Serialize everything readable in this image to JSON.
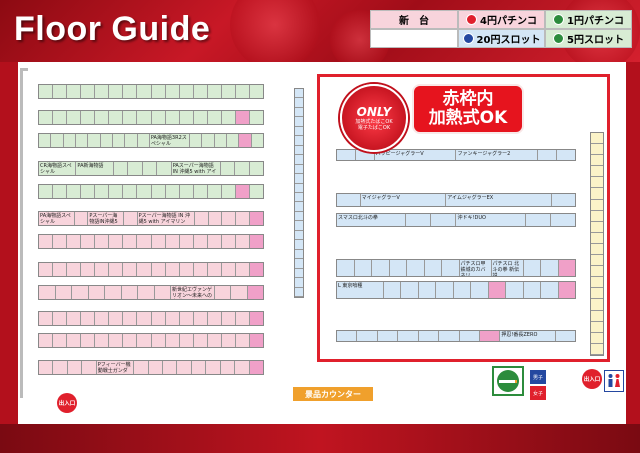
{
  "header": {
    "title": "Floor Guide"
  },
  "legend": {
    "items": [
      {
        "label": "新　台",
        "bg": "#f8d4dc",
        "dot": ""
      },
      {
        "label": "4円パチンコ",
        "bg": "#f8d4dc",
        "dot": "#e0202c",
        "num": "4"
      },
      {
        "label": "1円パチンコ",
        "bg": "#d8ecd4",
        "dot": "#2c8c3c",
        "num": "1"
      },
      {
        "label": "",
        "bg": "#ffffff",
        "dot": "",
        "num": ""
      },
      {
        "label": "20円スロット",
        "bg": "#d4e6f6",
        "dot": "#2448a0",
        "num": "20"
      },
      {
        "label": "5円スロット",
        "bg": "#d8ecd4",
        "dot": "#2c8c3c",
        "num": "5"
      }
    ]
  },
  "promo": {
    "only_badge_top": "ONLY",
    "only_badge_line1": "加熱式たばこOK",
    "only_badge_line2": "電子たばこOK",
    "heat_line1": "赤枠内",
    "heat_line2": "加熱式OK"
  },
  "rows": {
    "g1_labels": [
      "",
      "",
      "",
      "",
      "",
      "",
      "",
      "",
      "",
      "",
      "",
      "",
      "",
      "",
      "",
      "",
      "",
      "",
      "",
      "",
      "",
      ""
    ],
    "g3_big": [
      "CR海物語スペシャル",
      "PA新海物語"
    ],
    "g3_mid": "PAスーパー海物語 IN 沖縄5 with アイマリン",
    "g2_mid": "PA海物語3R2スペシャル",
    "p1_big": [
      "PA海物語スペシャル",
      "Pスーパー海物語IN沖縄5"
    ],
    "p1_mid": "Pスーパー海物語 IN 沖縄5 with アイマリン",
    "p2_mid": "新世紀エヴァンゲリオン～未来への咆哮～",
    "p4_mid": "Pフィーバー機動戦士ガンダム",
    "b1_cells": [
      "ハッピージャグラーV",
      "ファンキージャグラー2"
    ],
    "b2_cells": [
      "マイジャグラーV",
      "アイムジャグラーEX"
    ],
    "b3_cells": [
      "スマスロ北斗の拳",
      "沖ドキ!DUO"
    ],
    "b4_cells": [
      "パチスロ甲鉄城のカバネリ",
      "パチスロ 北斗の拳 新伝説"
    ],
    "b5_cells": [
      "L 東京喰種"
    ],
    "b6_cells": [
      "押忍!番長ZERO"
    ]
  },
  "facilities": {
    "exchange": "景品カウンター",
    "exit_label": "出入口",
    "wc_men": "男子",
    "wc_women": "女子"
  },
  "colors": {
    "green_slot": "#d8ecd4",
    "pink_slot": "#f8d4dc",
    "blue_slot": "#d4e6f6",
    "highlight": "#f0a0c8",
    "accent_red": "#e0202c"
  }
}
